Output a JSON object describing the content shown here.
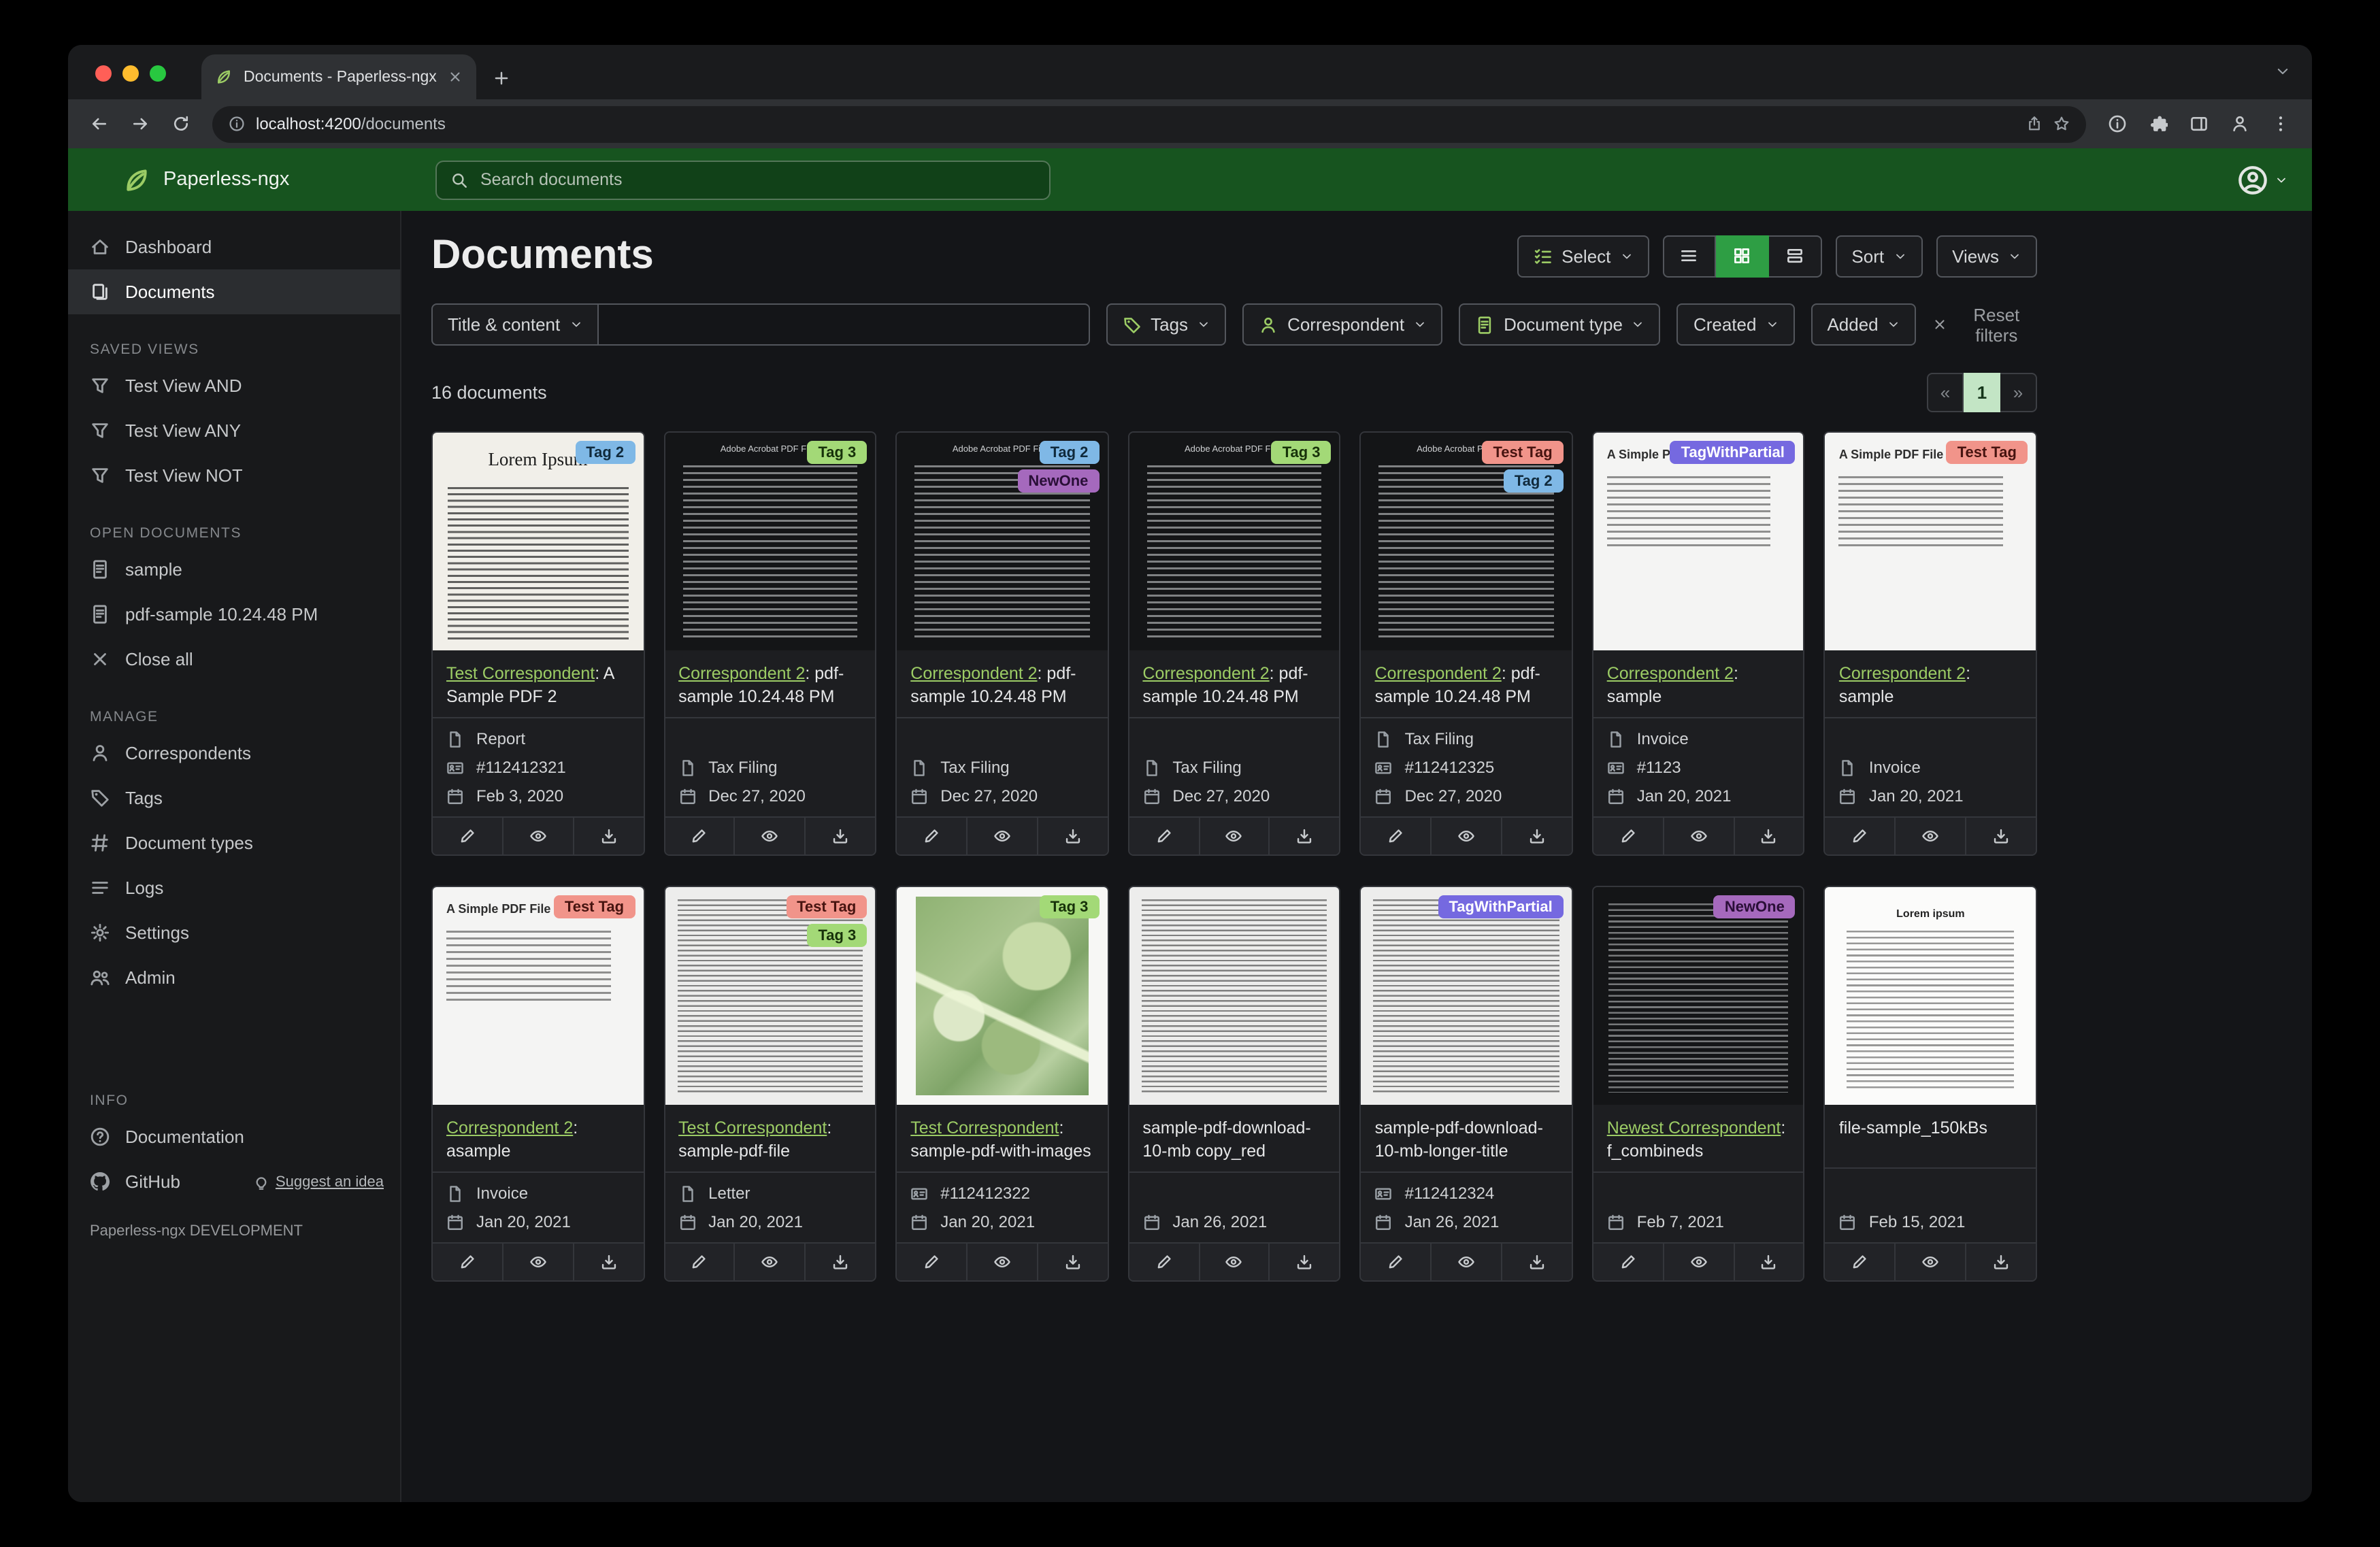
{
  "browser": {
    "tab_title": "Documents - Paperless-ngx",
    "url_host": "localhost:4200",
    "url_path": "/documents"
  },
  "header": {
    "brand": "Paperless-ngx",
    "search_placeholder": "Search documents"
  },
  "sidebar": {
    "nav": [
      {
        "label": "Dashboard",
        "icon": "home",
        "active": false
      },
      {
        "label": "Documents",
        "icon": "files",
        "active": true
      }
    ],
    "sections": [
      {
        "title": "SAVED VIEWS",
        "items": [
          {
            "label": "Test View AND",
            "icon": "funnel"
          },
          {
            "label": "Test View ANY",
            "icon": "funnel"
          },
          {
            "label": "Test View NOT",
            "icon": "funnel"
          }
        ]
      },
      {
        "title": "OPEN DOCUMENTS",
        "items": [
          {
            "label": "sample",
            "icon": "file-text"
          },
          {
            "label": "pdf-sample 10.24.48 PM",
            "icon": "file-text"
          },
          {
            "label": "Close all",
            "icon": "x"
          }
        ]
      },
      {
        "title": "MANAGE",
        "items": [
          {
            "label": "Correspondents",
            "icon": "person"
          },
          {
            "label": "Tags",
            "icon": "tag"
          },
          {
            "label": "Document types",
            "icon": "hash"
          },
          {
            "label": "Logs",
            "icon": "list"
          },
          {
            "label": "Settings",
            "icon": "gear"
          },
          {
            "label": "Admin",
            "icon": "people"
          }
        ]
      },
      {
        "title": "INFO",
        "items": [
          {
            "label": "Documentation",
            "icon": "question"
          },
          {
            "label": "GitHub",
            "icon": "github",
            "extra": "Suggest an idea",
            "extra_icon": "bulb"
          }
        ]
      }
    ],
    "footer": "Paperless-ngx DEVELOPMENT"
  },
  "toolbar": {
    "title": "Documents",
    "select_label": "Select",
    "sort_label": "Sort",
    "views_label": "Views"
  },
  "filters": {
    "title_content_label": "Title & content",
    "title_content_value": "",
    "tags_label": "Tags",
    "correspondent_label": "Correspondent",
    "document_type_label": "Document type",
    "created_label": "Created",
    "added_label": "Added",
    "reset_label": "Reset filters"
  },
  "results": {
    "count": "16 documents",
    "pagination": {
      "prev": "«",
      "page": "1",
      "next": "»"
    }
  },
  "tag_colors": {
    "Tag 2": {
      "bg": "#7fb8e6",
      "fg": "#102a3c"
    },
    "Tag 3": {
      "bg": "#a3d977",
      "fg": "#17320a"
    },
    "NewOne": {
      "bg": "#a569bd",
      "fg": "#2a0f38"
    },
    "Test Tag": {
      "bg": "#f1948a",
      "fg": "#471410"
    },
    "TagWithPartial": {
      "bg": "#7569e0",
      "fg": "#ffffff"
    }
  },
  "cards": [
    {
      "tags": [
        "Tag 2"
      ],
      "thumb": {
        "style": "lorem-serif",
        "label": "Lorem Ipsum"
      },
      "correspondent": "Test Correspondent",
      "title": ": A Sample PDF 2",
      "doc_type": "Report",
      "asn": "#112412321",
      "date": "Feb 3, 2020"
    },
    {
      "tags": [
        "Tag 3"
      ],
      "thumb": {
        "style": "pdf-dark",
        "label": "Adobe Acrobat PDF Files"
      },
      "correspondent": "Correspondent 2",
      "title": ": pdf-sample 10.24.48 PM",
      "doc_type": "Tax Filing",
      "asn": null,
      "date": "Dec 27, 2020"
    },
    {
      "tags": [
        "Tag 2",
        "NewOne"
      ],
      "thumb": {
        "style": "pdf-dark",
        "label": "Adobe Acrobat PDF Files"
      },
      "correspondent": "Correspondent 2",
      "title": ": pdf-sample 10.24.48 PM",
      "doc_type": "Tax Filing",
      "asn": null,
      "date": "Dec 27, 2020"
    },
    {
      "tags": [
        "Tag 3"
      ],
      "thumb": {
        "style": "pdf-dark",
        "label": "Adobe Acrobat PDF Files"
      },
      "correspondent": "Correspondent 2",
      "title": ": pdf-sample 10.24.48 PM",
      "doc_type": "Tax Filing",
      "asn": null,
      "date": "Dec 27, 2020"
    },
    {
      "tags": [
        "Test Tag",
        "Tag 2"
      ],
      "thumb": {
        "style": "pdf-dark",
        "label": "Adobe Acrobat PDF Files"
      },
      "correspondent": "Correspondent 2",
      "title": ": pdf-sample 10.24.48 PM",
      "doc_type": "Tax Filing",
      "asn": "#112412325",
      "date": "Dec 27, 2020"
    },
    {
      "tags": [
        "TagWithPartial"
      ],
      "thumb": {
        "style": "simple-light",
        "label": "A Simple PDF File"
      },
      "correspondent": "Correspondent 2",
      "title": ": sample",
      "doc_type": "Invoice",
      "asn": "#1123",
      "date": "Jan 20, 2021"
    },
    {
      "tags": [
        "Test Tag"
      ],
      "thumb": {
        "style": "simple-light",
        "label": "A Simple PDF File"
      },
      "correspondent": "Correspondent 2",
      "title": ": sample",
      "doc_type": "Invoice",
      "asn": null,
      "date": "Jan 20, 2021"
    },
    {
      "tags": [
        "Test Tag"
      ],
      "thumb": {
        "style": "simple-light",
        "label": "A Simple PDF File"
      },
      "correspondent": "Correspondent 2",
      "title": ": asample",
      "doc_type": "Invoice",
      "asn": null,
      "date": "Jan 20, 2021"
    },
    {
      "tags": [
        "Test Tag",
        "Tag 3"
      ],
      "thumb": {
        "style": "dense-light",
        "label": ""
      },
      "correspondent": "Test Correspondent",
      "title": ": sample-pdf-file",
      "doc_type": "Letter",
      "asn": null,
      "date": "Jan 20, 2021"
    },
    {
      "tags": [
        "Tag 3"
      ],
      "thumb": {
        "style": "map",
        "label": ""
      },
      "correspondent": "Test Correspondent",
      "title": ": sample-pdf-with-images",
      "doc_type": null,
      "asn": "#112412322",
      "date": "Jan 20, 2021"
    },
    {
      "tags": [],
      "thumb": {
        "style": "dense-light",
        "label": ""
      },
      "correspondent": null,
      "title": "sample-pdf-download-10-mb copy_red",
      "doc_type": null,
      "asn": null,
      "date": "Jan 26, 2021"
    },
    {
      "tags": [
        "TagWithPartial"
      ],
      "thumb": {
        "style": "dense-light",
        "label": ""
      },
      "correspondent": null,
      "title": "sample-pdf-download-10-mb-longer-title",
      "doc_type": null,
      "asn": "#112412324",
      "date": "Jan 26, 2021"
    },
    {
      "tags": [
        "NewOne"
      ],
      "thumb": {
        "style": "pdf-dark-plain",
        "label": ""
      },
      "correspondent": "Newest Correspondent",
      "title": ": f_combineds",
      "doc_type": null,
      "asn": null,
      "date": "Feb 7, 2021"
    },
    {
      "tags": [],
      "thumb": {
        "style": "lorem-center",
        "label": "Lorem ipsum"
      },
      "correspondent": null,
      "title": "file-sample_150kBs",
      "doc_type": null,
      "asn": null,
      "date": "Feb 15, 2021"
    }
  ]
}
